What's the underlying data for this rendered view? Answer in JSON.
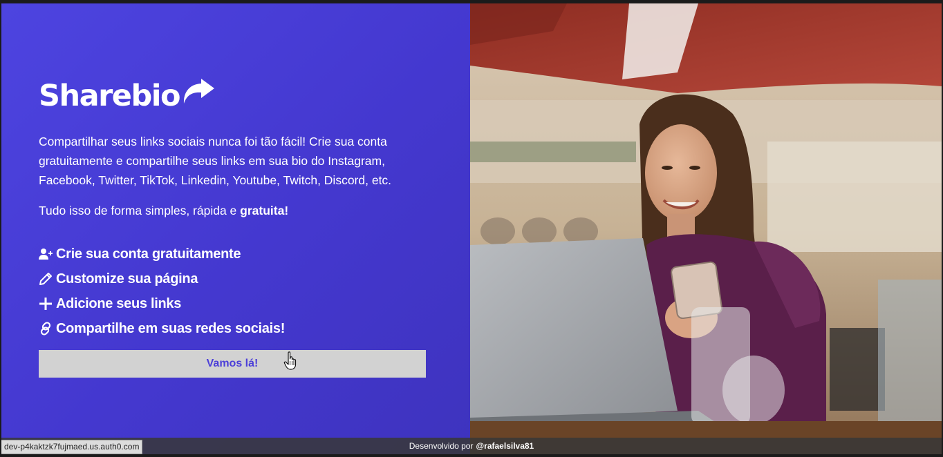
{
  "brand": {
    "name": "Sharebio",
    "icon": "share-arrow-icon"
  },
  "intro": {
    "description": "Compartilhar seus links sociais nunca foi tão fácil! Crie sua conta gratuitamente e compartilhe seus links em sua bio do Instagram, Facebook, Twitter, TikTok, Linkedin, Youtube, Twitch, Discord, etc.",
    "tagline_prefix": "Tudo isso de forma simples, rápida e ",
    "tagline_bold": "gratuita!"
  },
  "features": [
    {
      "icon": "user-plus-icon",
      "label": "Crie sua conta gratuitamente"
    },
    {
      "icon": "pencil-icon",
      "label": "Customize sua página"
    },
    {
      "icon": "plus-icon",
      "label": "Adicione seus links"
    },
    {
      "icon": "link-icon",
      "label": "Compartilhe em suas redes sociais!"
    }
  ],
  "cta": {
    "label": "Vamos lá!"
  },
  "footer": {
    "prefix": "Desenvolvido por",
    "author": "@rafaelsilva81"
  },
  "status_bar": {
    "url": "dev-p4kaktzk7fujmaed.us.auth0.com"
  },
  "colors": {
    "panel": "#4438cf",
    "button_bg": "#d2d2d2",
    "button_text": "#4c3fd8",
    "text": "#ffffff"
  }
}
